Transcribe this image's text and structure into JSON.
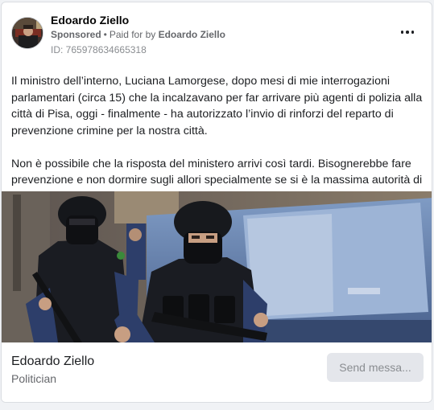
{
  "post": {
    "page_name": "Edoardo Ziello",
    "sponsored_label": "Sponsored",
    "separator": "•",
    "paid_for_label": "Paid for by",
    "paid_for_name": "Edoardo Ziello",
    "ad_id": "ID: 765978634665318",
    "more_icon": "more-horizontal-icon",
    "paragraph_1": "Il ministro dell’interno, Luciana Lamorgese, dopo mesi di mie interrogazioni parlamentari (circa 15) che la incalzavano per far arrivare più agenti di polizia alla città di Pisa, oggi - finalmente - ha autorizzato l’invio di rinforzi del reparto di prevenzione crimine per la nostra città.",
    "paragraph_2_line_1": "Non è possibile che la risposta del ministero arrivi così tardi. Bisognerebbe fare",
    "paragraph_2_line_2": "prevenzione e non dormire sugli allori specialmente se si è la massima autorità di…"
  },
  "footer": {
    "page_name": "Edoardo Ziello",
    "category": "Politician",
    "cta_label": "Send messa..."
  },
  "colors": {
    "text_primary": "#1c1e21",
    "text_secondary": "#65676b",
    "button_bg": "#e4e6eb",
    "police_blue": "#2d3e6a"
  }
}
